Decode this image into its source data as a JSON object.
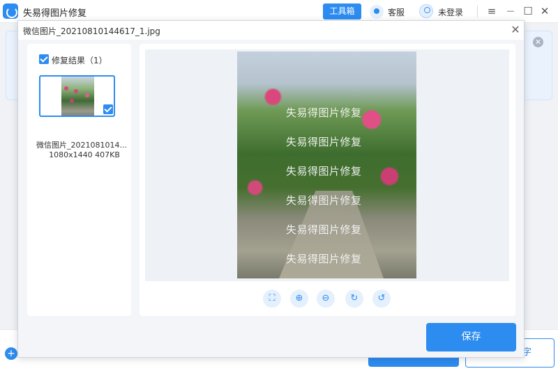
{
  "app": {
    "title": "失易得图片修复",
    "toolbox_label": "工具箱",
    "customer_service_label": "客服",
    "login_label": "未登录",
    "window_controls": {
      "menu": "≡",
      "minimize": "—",
      "maximize": "☐",
      "close": "✕"
    }
  },
  "background": {
    "banner_close": "✕",
    "add_icon": "+",
    "secondary_button_tail": "字"
  },
  "dialog": {
    "title": "微信图片_20210810144617_1.jpg",
    "close_label": "✕",
    "results": {
      "header_label": "修复结果（1）",
      "checked": true,
      "items": [
        {
          "name": "微信图片_2021081014...",
          "meta": "1080x1440 407KB",
          "checked": true
        }
      ]
    },
    "preview": {
      "watermark_lines": [
        "失易得图片修复",
        "失易得图片修复",
        "失易得图片修复",
        "失易得图片修复",
        "失易得图片修复",
        "失易得图片修复"
      ]
    },
    "tools": [
      {
        "name": "fit-screen",
        "glyph": "⛶"
      },
      {
        "name": "zoom-in",
        "glyph": "⊕"
      },
      {
        "name": "zoom-out",
        "glyph": "⊖"
      },
      {
        "name": "rotate-right",
        "glyph": "↻"
      },
      {
        "name": "rotate-left",
        "glyph": "↺"
      }
    ],
    "save_label": "保存"
  },
  "colors": {
    "accent": "#2d8cf0",
    "panel_bg": "#ffffff",
    "dialog_bg": "#f3f5f8"
  }
}
